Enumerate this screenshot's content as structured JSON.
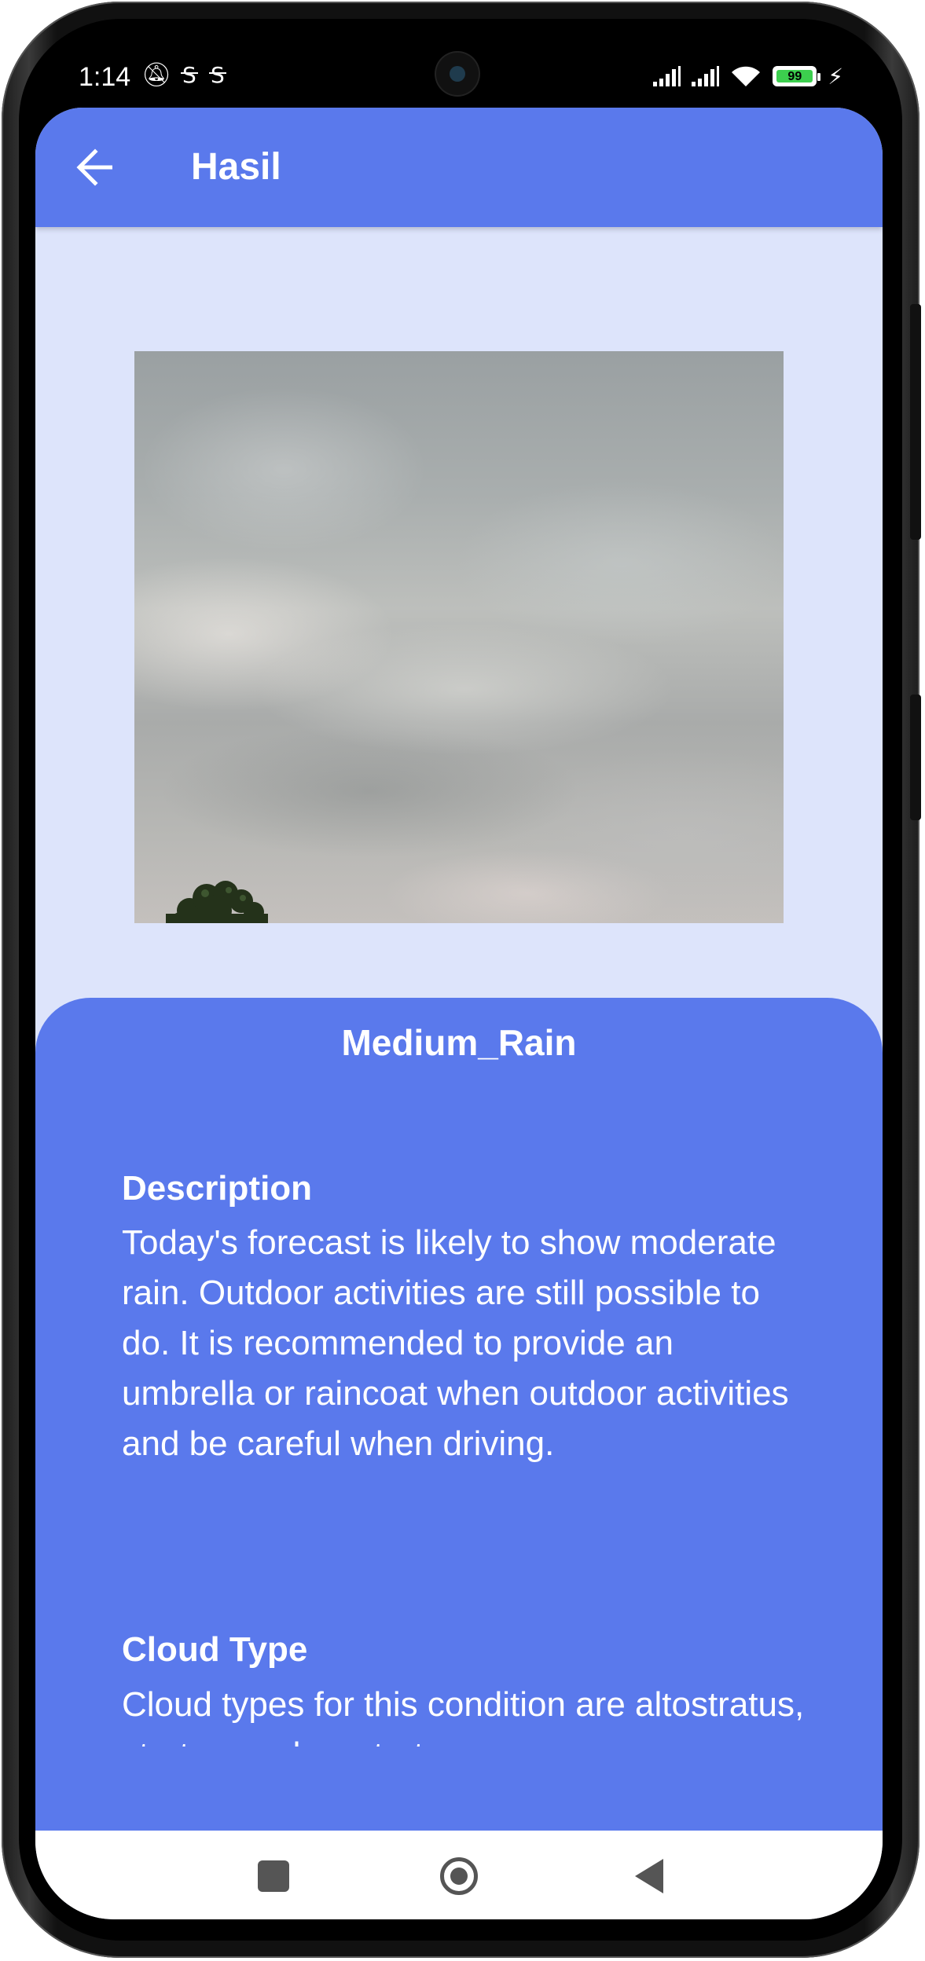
{
  "status_bar": {
    "time": "1:14",
    "left_icons": "∅ S S",
    "battery_level": "99"
  },
  "app_bar": {
    "title": "Hasil"
  },
  "result": {
    "label": "Medium_Rain",
    "description_heading": "Description",
    "description_text": "Today's forecast is likely to show moderate rain. Outdoor activities are still possible to do. It is recommended to provide an umbrella or raincoat when outdoor activities and be careful when driving.",
    "cloud_type_heading": "Cloud Type",
    "cloud_type_text": "Cloud types for this condition are altostratus, stratocumulus, stratus"
  },
  "colors": {
    "accent": "#5a79ec",
    "background": "#dde4fb"
  },
  "icons": {
    "back": "arrow-left-icon",
    "nav_recents": "square-icon",
    "nav_home": "circle-icon",
    "nav_back": "triangle-back-icon"
  }
}
